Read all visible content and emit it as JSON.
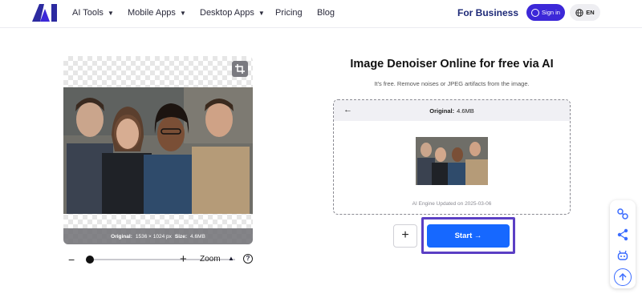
{
  "header": {
    "logo_alt": "AI",
    "nav": [
      {
        "label": "AI Tools",
        "has_dropdown": true
      },
      {
        "label": "Mobile Apps",
        "has_dropdown": true
      },
      {
        "label": "Desktop Apps",
        "has_dropdown": true
      },
      {
        "label": "Pricing",
        "has_dropdown": false
      },
      {
        "label": "Blog",
        "has_dropdown": false
      }
    ],
    "business_label": "For Business",
    "signin_label": "Sign in",
    "language_label": "EN",
    "brand_color": "#3c28d8"
  },
  "preview": {
    "original_label": "Original:",
    "original_dims": "1536 × 1024 px",
    "size_label": "Size:",
    "size_value": "4.6MB",
    "zoom_label": "Zoom",
    "zoom_level": 0.0
  },
  "tool": {
    "title": "Image Denoiser Online for free via AI",
    "subtitle": "It's free. Remove noises or JPEG artifacts from the image.",
    "original_label": "Original:",
    "original_size": "4.6MB",
    "engine_note": "AI Engine Updated on 2025-03-06",
    "add_label": "+",
    "start_label": "Start →",
    "start_color": "#1668ff",
    "highlight_color": "#5b3fc4"
  },
  "floating_toolbar": {
    "icons": [
      "link-icon",
      "share-icon",
      "robot-icon",
      "arrow-up-icon"
    ]
  }
}
